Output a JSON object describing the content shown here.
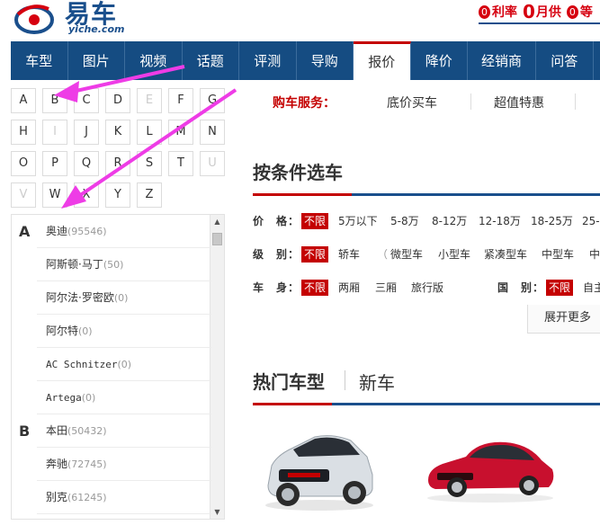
{
  "header": {
    "logo_cn": "易车",
    "logo_en": "yiche.com",
    "promos": [
      {
        "num": "0",
        "text": "利率",
        "zero_badge": true
      },
      {
        "num": "0",
        "text": "月供",
        "zero_badge": false
      },
      {
        "num": "0",
        "text": "等",
        "zero_badge": true
      }
    ]
  },
  "nav": {
    "items": [
      "车型",
      "图片",
      "视频",
      "话题",
      "评测",
      "导购",
      "报价",
      "降价",
      "经销商",
      "问答"
    ],
    "active_index": 6
  },
  "letters": {
    "rows": [
      [
        {
          "l": "A",
          "on": true
        },
        {
          "l": "B",
          "on": true
        },
        {
          "l": "C",
          "on": true
        },
        {
          "l": "D",
          "on": true
        },
        {
          "l": "E",
          "on": false
        },
        {
          "l": "F",
          "on": true
        },
        {
          "l": "G",
          "on": true
        }
      ],
      [
        {
          "l": "H",
          "on": true
        },
        {
          "l": "I",
          "on": false
        },
        {
          "l": "J",
          "on": true
        },
        {
          "l": "K",
          "on": true
        },
        {
          "l": "L",
          "on": true
        },
        {
          "l": "M",
          "on": true
        },
        {
          "l": "N",
          "on": true
        }
      ],
      [
        {
          "l": "O",
          "on": true
        },
        {
          "l": "P",
          "on": true
        },
        {
          "l": "Q",
          "on": true
        },
        {
          "l": "R",
          "on": true
        },
        {
          "l": "S",
          "on": true
        },
        {
          "l": "T",
          "on": true
        },
        {
          "l": "U",
          "on": false
        }
      ],
      [
        {
          "l": "V",
          "on": false
        },
        {
          "l": "W",
          "on": true
        },
        {
          "l": "X",
          "on": true
        },
        {
          "l": "Y",
          "on": true
        },
        {
          "l": "Z",
          "on": true
        }
      ]
    ]
  },
  "brands": {
    "groups": [
      {
        "letter": "A",
        "items": [
          {
            "name": "奥迪",
            "count": "(95546)"
          },
          {
            "name": "阿斯顿·马丁",
            "count": "(50)"
          },
          {
            "name": "阿尔法·罗密欧",
            "count": "(0)"
          },
          {
            "name": "阿尔特",
            "count": "(0)"
          },
          {
            "name": "AC Schnitzer",
            "count": "(0)"
          },
          {
            "name": "Artega",
            "count": "(0)"
          }
        ]
      },
      {
        "letter": "B",
        "items": [
          {
            "name": "本田",
            "count": "(50432)"
          },
          {
            "name": "奔驰",
            "count": "(72745)"
          },
          {
            "name": "别克",
            "count": "(61245)"
          }
        ]
      }
    ]
  },
  "service": {
    "label": "购车服务：",
    "links": [
      "底价买车",
      "超值特惠"
    ]
  },
  "filter": {
    "title": "按条件选车",
    "rows": [
      {
        "key": "价　格：",
        "options": [
          "不限",
          "5万以下",
          "5-8万",
          "8-12万",
          "12-18万",
          "18-25万",
          "25-"
        ]
      },
      {
        "key": "级　别：",
        "options": [
          "不限",
          "轿车",
          "（",
          "微型车",
          "小型车",
          "紧凑型车",
          "中型车",
          "中"
        ]
      },
      {
        "key": "车　身：",
        "options": [
          "不限",
          "两厢",
          "三厢",
          "旅行版"
        ]
      }
    ],
    "country_key": "国　别：",
    "country_options": [
      "不限",
      "自主"
    ],
    "expand": "展开更多"
  },
  "hot": {
    "title": "热门车型",
    "tab": "新车"
  },
  "colors": {
    "nav_bg": "#154c82",
    "accent_red": "#c40000",
    "accent_blue": "#1a4f8c",
    "annotation_arrow": "#ee3ce6"
  }
}
